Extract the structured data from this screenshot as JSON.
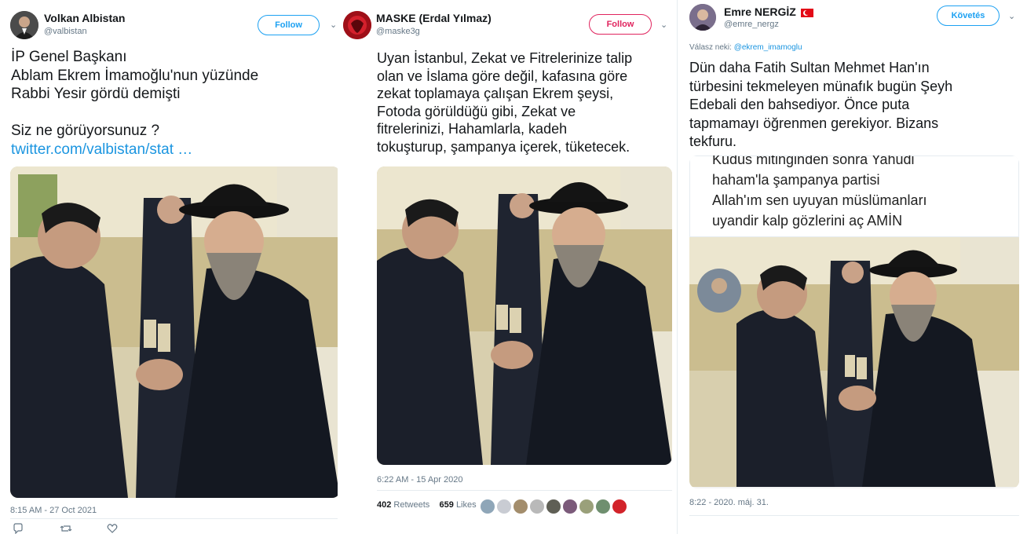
{
  "tweets": [
    {
      "name": "Volkan Albistan",
      "handle": "@valbistan",
      "follow_label": "Follow",
      "text_lines": [
        "İP Genel Başkanı",
        "Ablam Ekrem İmamoğlu'nun yüzünde",
        "Rabbi Yesir gördü demişti",
        "",
        "Siz ne görüyorsunuz ?"
      ],
      "link": "twitter.com/valbistan/stat …",
      "timestamp": "8:15 AM - 27 Oct 2021",
      "icons": [
        "reply-icon",
        "retweet-icon",
        "like-icon"
      ]
    },
    {
      "name": "MASKE (Erdal Yılmaz)",
      "handle": "@maske3g",
      "follow_label": "Follow",
      "text_lines": [
        "Uyan İstanbul, Zekat ve Fitrelerinize talip",
        "olan ve İslama göre değil, kafasına göre",
        "zekat toplamaya çalışan Ekrem şeysi,",
        "Fotoda görüldüğü gibi, Zekat ve",
        "fitrelerinizi, Hahamlarla, kadeh",
        "tokuşturup, şampanya içerek, tüketecek."
      ],
      "timestamp": "6:22 AM - 15 Apr 2020",
      "retweets": "402",
      "retweets_label": "Retweets",
      "likes": "659",
      "likes_label": "Likes"
    },
    {
      "name": "Emre NERGİZ",
      "flag": "🇹🇷",
      "handle": "@emre_nergz",
      "follow_label": "Követés",
      "reply_prefix": "Válasz neki:",
      "reply_handle": "@ekrem_imamoglu",
      "text_lines": [
        "Dün daha Fatih Sultan Mehmet Han'ın",
        "türbesini tekmeleyen münafık bugün Şeyh",
        "Edebali den bahsediyor. Önce puta",
        "tapmamayı öğrenmen gerekiyor. Bizans",
        "tekfuru."
      ],
      "quote_lines": [
        "Kudüs mitinginden sonra Yahudi",
        "haham'la şampanya partisi",
        "Allah'ım sen uyuyan müslümanları",
        "uyandir kalp gözlerini aç AMİN"
      ],
      "timestamp": "8:22 - 2020. máj. 31."
    }
  ],
  "colors": {
    "link_blue": "#1b95e0",
    "follow_blue": "#1da1f2",
    "follow_red": "#e0245e",
    "muted": "#657786"
  }
}
